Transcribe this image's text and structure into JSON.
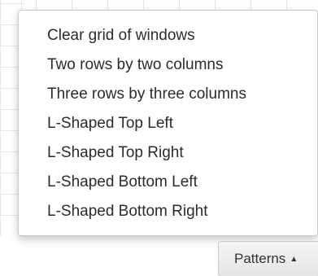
{
  "menu": {
    "items": [
      {
        "label": "Clear grid of windows"
      },
      {
        "label": "Two rows by two columns"
      },
      {
        "label": "Three rows by three columns"
      },
      {
        "label": "L-Shaped Top Left"
      },
      {
        "label": "L-Shaped Top Right"
      },
      {
        "label": "L-Shaped Bottom Left"
      },
      {
        "label": "L-Shaped Bottom Right"
      }
    ]
  },
  "patterns_button": {
    "label": "Patterns",
    "icon": "caret-up-icon"
  },
  "colors": {
    "text": "#2b2b2b",
    "grid": "#dfe6ef",
    "border": "#c9c9c9"
  }
}
